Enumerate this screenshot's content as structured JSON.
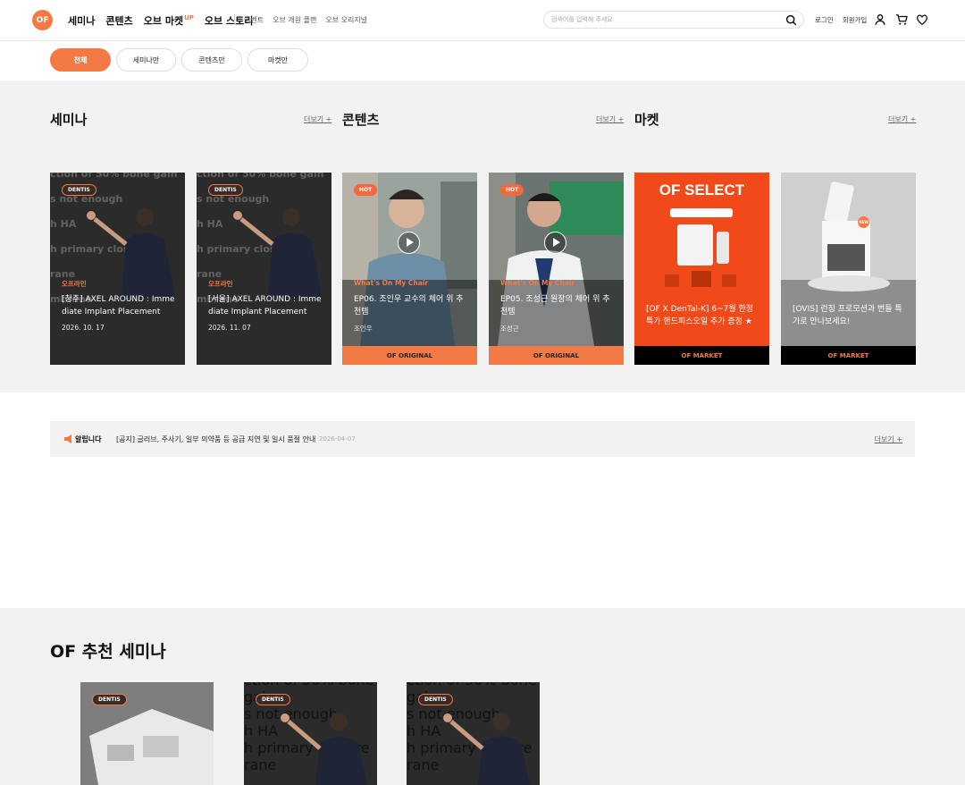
{
  "header": {
    "logo": "OF",
    "main_nav": [
      "세미나",
      "콘텐츠",
      "오브 마켓",
      "오브 스토리"
    ],
    "market_badge": "UP",
    "sub_nav": [
      "이벤트",
      "오브 개원 플랜",
      "오브 오리지널"
    ],
    "search_placeholder": "검색어를 입력해 주세요",
    "login": "로그인",
    "signup": "회원가입"
  },
  "filter_tabs": [
    {
      "label": "전체",
      "active": true
    },
    {
      "label": "세미나만",
      "active": false
    },
    {
      "label": "콘텐츠만",
      "active": false
    },
    {
      "label": "마켓만",
      "active": false
    }
  ],
  "sections": {
    "seminar": {
      "title": "세미나",
      "more": "더보기 +"
    },
    "content": {
      "title": "콘텐츠",
      "more": "더보기 +"
    },
    "market": {
      "title": "마켓",
      "more": "더보기 +"
    }
  },
  "cards": [
    {
      "badge": "DENTIS",
      "category": "오프라인",
      "title": "[청주] AXEL AROUND : Imme diate Implant Placement",
      "sub": "2026. 10. 17",
      "bg_lines": [
        "ction of 50% bone gain",
        "s not enough",
        "h HA",
        "h primary closure",
        "rane",
        "mbrane"
      ]
    },
    {
      "badge": "DENTIS",
      "category": "오프라인",
      "title": "[서울] AXEL AROUND : Imme diate Implant Placement",
      "sub": "2026. 11. 07",
      "bg_lines": [
        "ction of 50% bone gain",
        "s not enough",
        "h HA",
        "h primary closure",
        "rane",
        "mbrane"
      ]
    },
    {
      "badge": "HOT",
      "category": "What's On My Chair",
      "title": "EP06. 조인우 교수의 체어 위 추천템",
      "sub": "조인우",
      "footer": "OF ORIGINAL"
    },
    {
      "badge": "HOT",
      "category": "What's On My Chair",
      "title": "EP05. 조성근 원장의 체어 위 추천템",
      "sub": "조성근",
      "footer": "OF ORIGINAL"
    },
    {
      "headline": "OF SELECT",
      "title": "[OF X DenTal-K] 6~7월 한정 특가 핸드피스오일 추가 증정 ★",
      "footer": "OF MARKET"
    },
    {
      "badge": "NEW",
      "title": "[OVIS] 런칭 프로모션과 번들 특가로 만나보세요!",
      "footer": "OF MARKET"
    }
  ],
  "notice": {
    "label": "알립니다",
    "text": "[공지] 글러브, 주사기, 일부 의약품 등 공급 지연 및 일시 품절 안내",
    "date": "2026-04-07",
    "more": "더보기 +"
  },
  "recommended": {
    "title": "OF 추천 세미나",
    "badges": [
      "DENTIS",
      "DENTIS",
      "DENTIS"
    ]
  },
  "colors": {
    "accent": "#f47a45",
    "band": "#f2f2f2"
  }
}
